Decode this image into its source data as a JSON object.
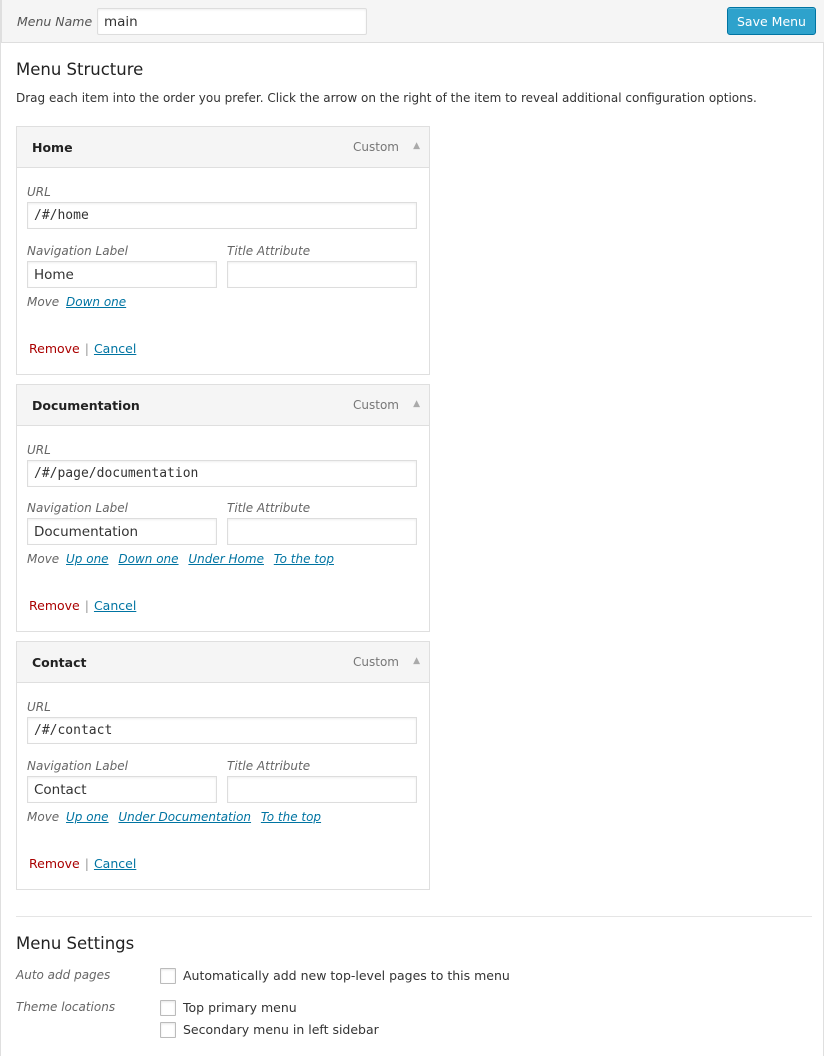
{
  "header": {
    "menu_name_label": "Menu Name",
    "menu_name_value": "main",
    "save_button": "Save Menu"
  },
  "structure": {
    "title": "Menu Structure",
    "instructions": "Drag each item into the order you prefer. Click the arrow on the right of the item to reveal additional configuration options."
  },
  "labels": {
    "url": "URL",
    "nav_label": "Navigation Label",
    "title_attr": "Title Attribute",
    "move": "Move",
    "remove": "Remove",
    "separator": "|",
    "cancel": "Cancel"
  },
  "items": [
    {
      "title": "Home",
      "type": "Custom",
      "arrow": "▲",
      "url": "/#/home",
      "nav_label": "Home",
      "title_attr": "",
      "move_links": [
        "Down one"
      ]
    },
    {
      "title": "Documentation",
      "type": "Custom",
      "arrow": "▲",
      "url": "/#/page/documentation",
      "nav_label": "Documentation",
      "title_attr": "",
      "move_links": [
        "Up one",
        "Down one",
        "Under Home",
        "To the top"
      ]
    },
    {
      "title": "Contact",
      "type": "Custom",
      "arrow": "▲",
      "url": "/#/contact",
      "nav_label": "Contact",
      "title_attr": "",
      "move_links": [
        "Up one",
        "Under Documentation",
        "To the top"
      ]
    }
  ],
  "settings": {
    "title": "Menu Settings",
    "auto_add_label": "Auto add pages",
    "auto_add_option": "Automatically add new top-level pages to this menu",
    "theme_locations_label": "Theme locations",
    "location_top": "Top primary menu",
    "location_secondary": "Secondary menu in left sidebar"
  },
  "colors": {
    "accent": "#2ea2cc",
    "link": "#0074a2",
    "remove": "#aa0000"
  }
}
